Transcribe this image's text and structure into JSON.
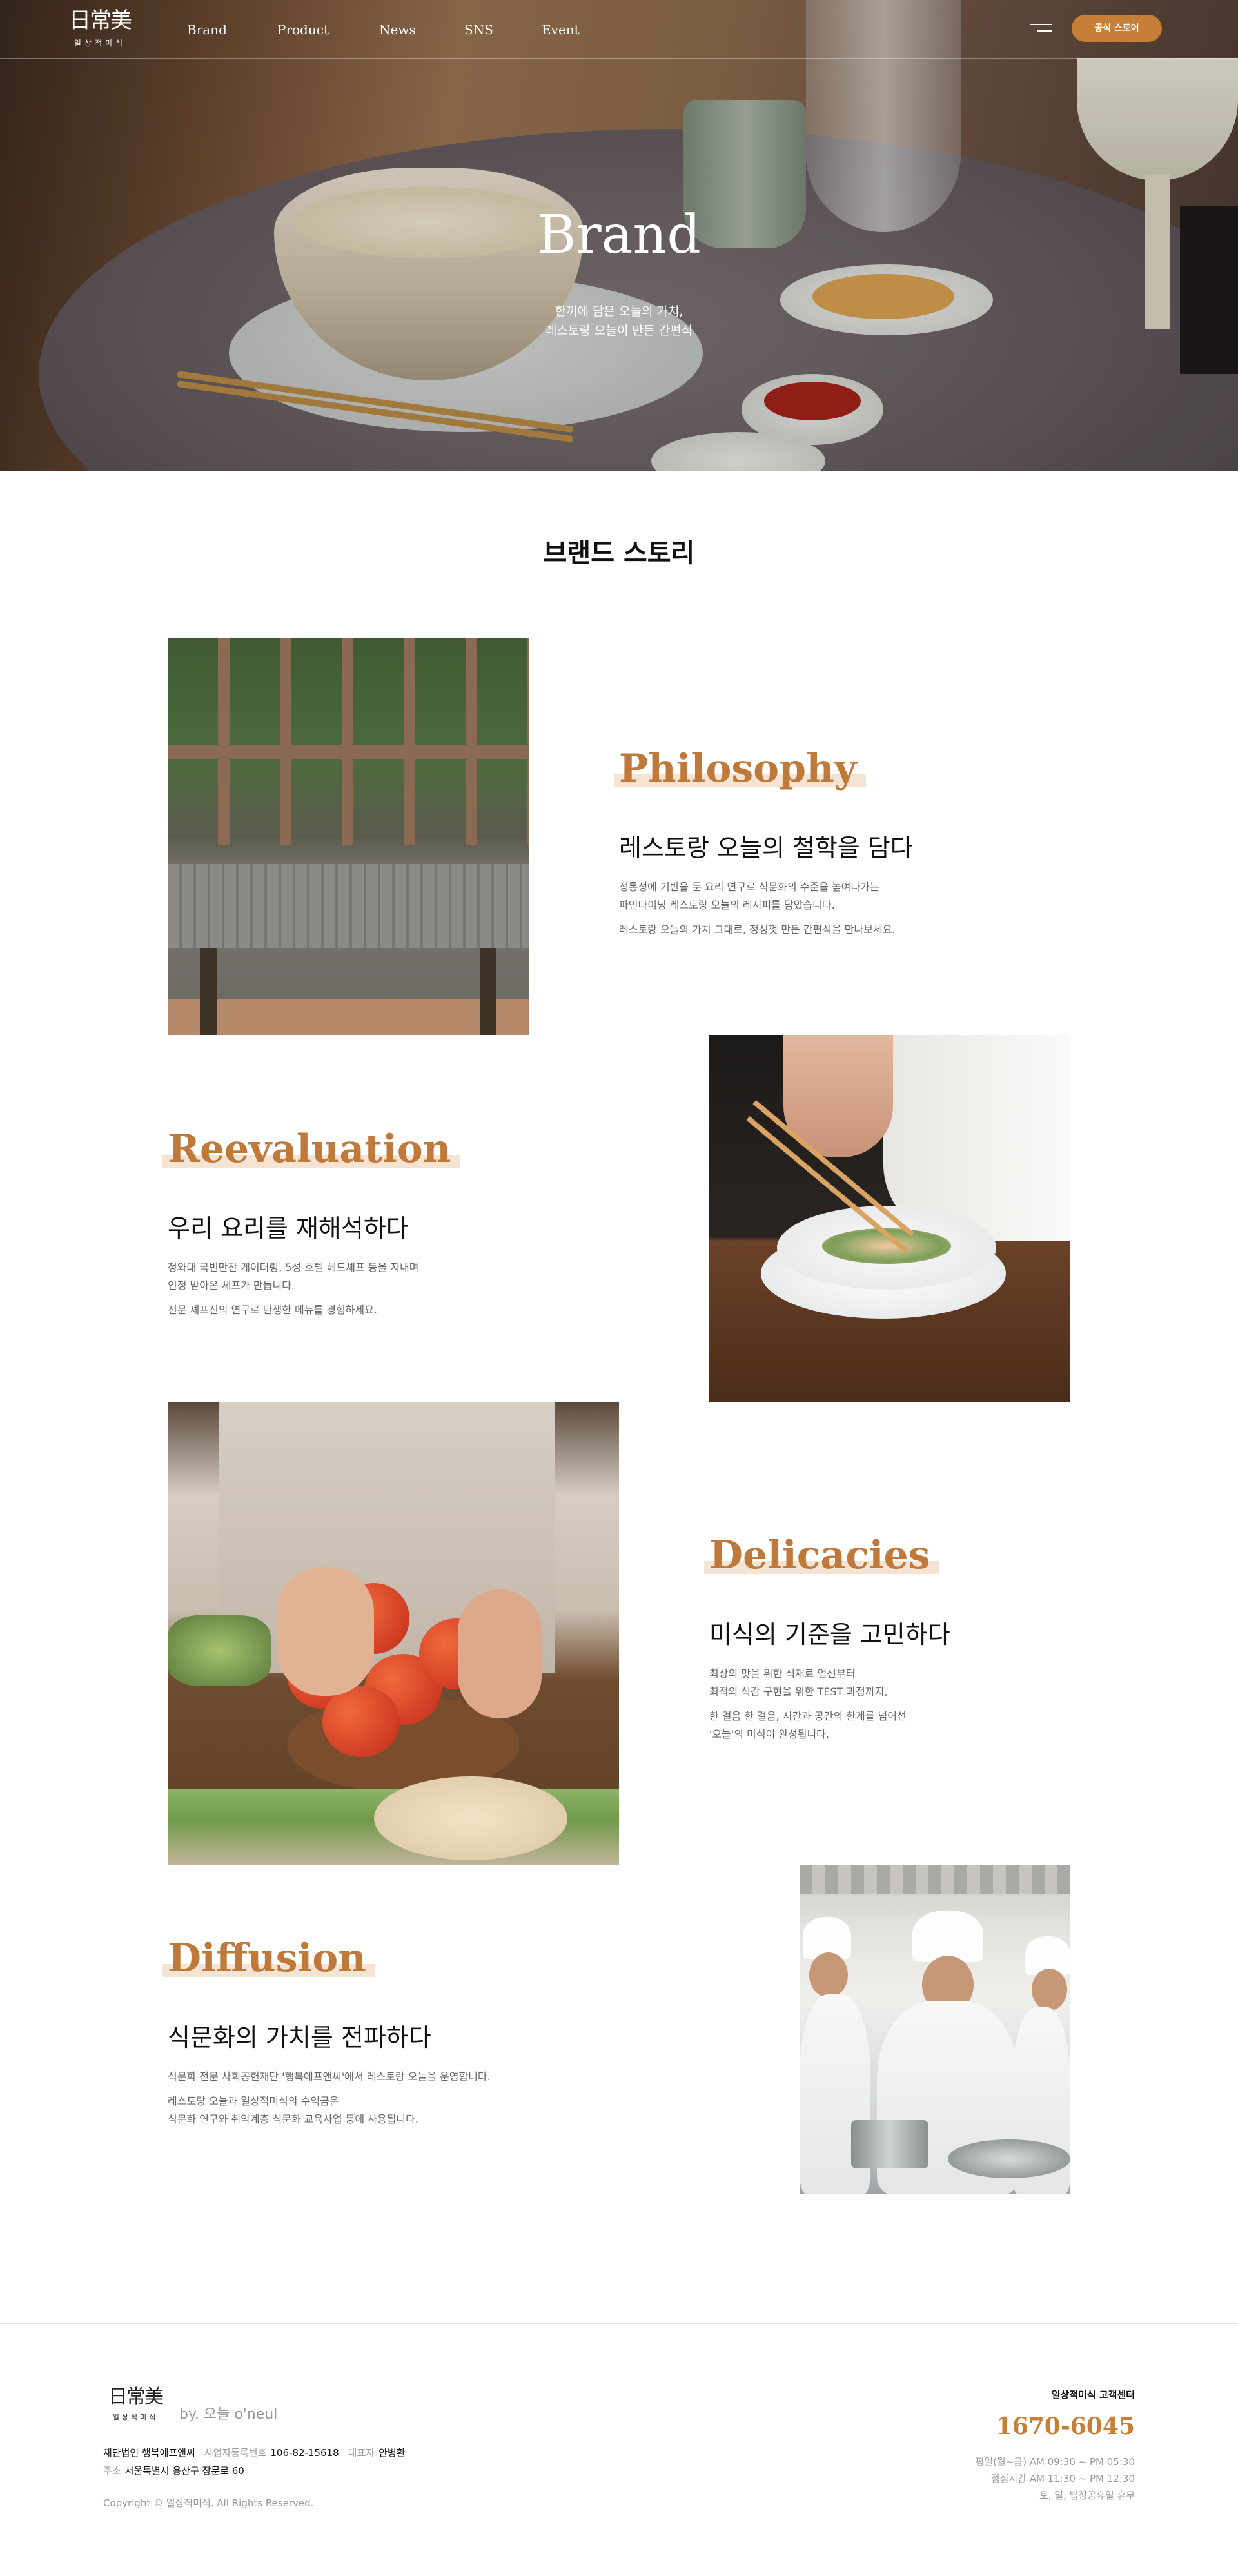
{
  "header": {
    "logo_mark": "日常美",
    "logo_sub": "일상적미식",
    "nav": [
      "Brand",
      "Product",
      "News",
      "SNS",
      "Event"
    ],
    "store_button": "공식 스토어"
  },
  "hero": {
    "title": "Brand",
    "subtitle_lines": [
      "한끼에 담은 오늘의 가치,",
      "레스토랑 오늘이 만든 간편식"
    ]
  },
  "page_title": "브랜드 스토리",
  "sections": [
    {
      "heading": "Philosophy",
      "subheading": "레스토랑 오늘의 철학을 담다",
      "body": [
        "정통성에 기반을 둔 요리 연구로 식문화의 수준을 높여나가는",
        "파인다이닝 레스토랑 오늘의 레시피를 담았습니다.",
        "레스토랑 오늘의 가치 그대로, 정성껏 만든 간편식을 만나보세요."
      ]
    },
    {
      "heading": "Reevaluation",
      "subheading": "우리 요리를 재해석하다",
      "body": [
        "청와대 국빈만찬 케이터링, 5성 호텔 헤드셰프 등을 지내며",
        "인정 받아온 셰프가 만듭니다.",
        "전문 셰프진의 연구로 탄생한 메뉴를 경험하세요."
      ]
    },
    {
      "heading": "Delicacies",
      "subheading": "미식의 기준을 고민하다",
      "body": [
        "최상의 맛을 위한 식재료 엄선부터",
        "최적의 식감 구현을 위한 TEST 과정까지,",
        "한 걸음 한 걸음, 시간과 공간의 한계를 넘어선",
        "'오늘'의 미식이 완성됩니다."
      ]
    },
    {
      "heading": "Diffusion",
      "subheading": "식문화의 가치를 전파하다",
      "body": [
        "식문화 전문 사회공헌재단 '행복에프앤씨'에서 레스토랑 오늘을 운영합니다.",
        "레스토랑 오늘과 일상적미식의 수익금은",
        "식문화 연구와 취약계층 식문화 교육사업 등에 사용됩니다."
      ]
    }
  ],
  "footer": {
    "logo_mark": "日常美",
    "logo_sub": "일상적미식",
    "by_text": "by. 오늘 o'neul",
    "company": "재단법인 행복에프앤씨",
    "biz_label": "사업자등록번호",
    "biz_no": "106-82-15618",
    "ceo_label": "대표자",
    "ceo": "안병환",
    "addr_label": "주소",
    "address": "서울특별시 용산구 장문로 60",
    "copyright": "Copyright © 일상적미식. All Rights Reserved.",
    "cs_title": "일상적미식 고객센터",
    "phone": "1670-6045",
    "hours": [
      "평일(월~금) AM 09:30 ~ PM 05:30",
      "점심시간 AM 11:30 ~ PM 12:30",
      "토, 일, 법정공휴일 휴무"
    ]
  },
  "colors": {
    "accent": "#c77e36",
    "heading": "#bf7a3b",
    "highlight": "#f5e3d3"
  }
}
